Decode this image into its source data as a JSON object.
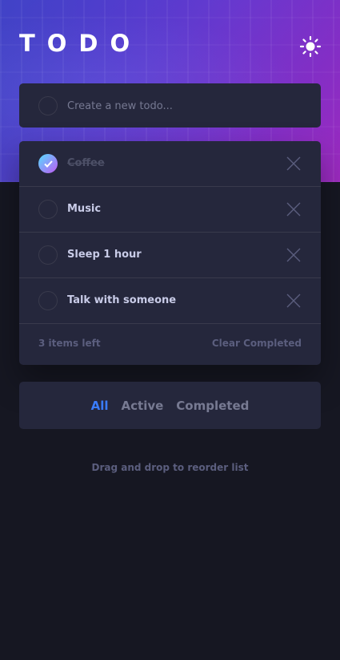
{
  "header": {
    "title": "TODO",
    "theme_icon": "sun-icon"
  },
  "new_todo": {
    "placeholder": "Create a new todo..."
  },
  "todos": [
    {
      "text": "Coffee",
      "completed": true
    },
    {
      "text": "Music",
      "completed": false
    },
    {
      "text": "Sleep 1 hour",
      "completed": false
    },
    {
      "text": "Talk with someone",
      "completed": false
    }
  ],
  "footer": {
    "items_left": "3 items left",
    "clear_completed": "Clear Completed"
  },
  "filters": {
    "all": "All",
    "active": "Active",
    "completed": "Completed",
    "selected": "All"
  },
  "hint": "Drag and drop to reorder list",
  "colors": {
    "background": "#161722",
    "card": "#25273c",
    "accent": "#3a7cfd",
    "check_gradient_start": "#55ddff",
    "check_gradient_end": "#c058f3"
  }
}
